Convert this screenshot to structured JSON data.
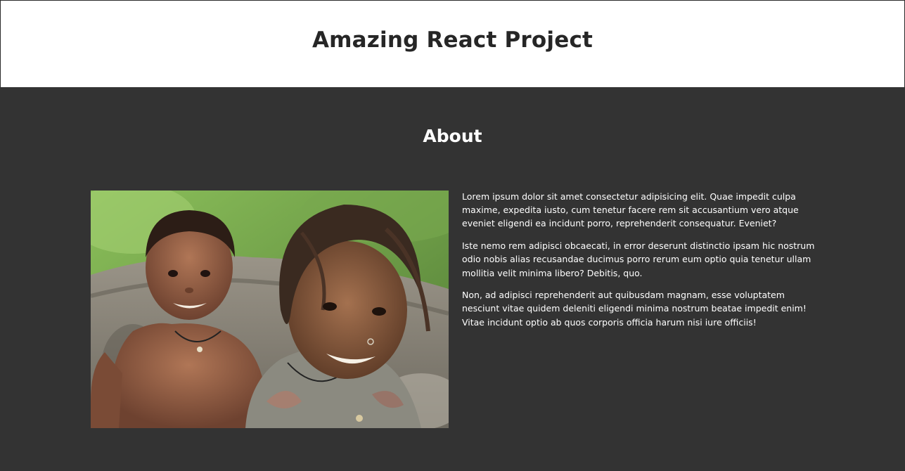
{
  "header": {
    "title": "Amazing React Project"
  },
  "about": {
    "heading": "About",
    "photo": {
      "alt": "Two smiling children, a boy and a girl"
    },
    "paragraphs": [
      "Lorem ipsum dolor sit amet consectetur adipisicing elit. Quae impedit culpa maxime, expedita iusto, cum tenetur facere rem sit accusantium vero atque eveniet eligendi ea incidunt porro, reprehenderit consequatur. Eveniet?",
      "Iste nemo rem adipisci obcaecati, in error deserunt distinctio ipsam hic nostrum odio nobis alias recusandae ducimus porro rerum eum optio quia tenetur ullam mollitia velit minima libero? Debitis, quo.",
      "Non, ad adipisci reprehenderit aut quibusdam magnam, esse voluptatem nesciunt vitae quidem deleniti eligendi minima nostrum beatae impedit enim! Vitae incidunt optio ab quos corporis officia harum nisi iure officiis!"
    ]
  },
  "colors": {
    "header_background": "#ffffff",
    "header_text": "#262626",
    "section_background": "#333333",
    "section_text": "#ffffff"
  }
}
